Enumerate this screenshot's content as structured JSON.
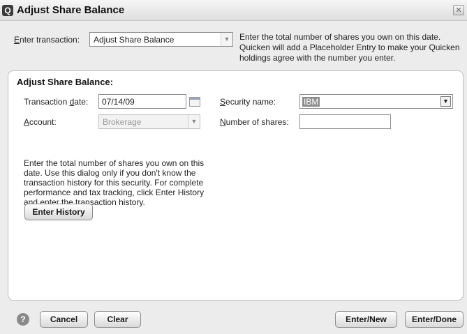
{
  "window": {
    "app_icon": "Q",
    "title": "Adjust Share Balance",
    "close_glyph": "✕"
  },
  "header": {
    "enter_transaction_label": "Enter transaction:",
    "transaction_type_value": "Adjust Share Balance",
    "info_text": "Enter the total number of shares you own on this date. Quicken will add a Placeholder Entry to make your Quicken holdings agree with the number you enter."
  },
  "panel": {
    "title": "Adjust Share Balance:",
    "transaction_date_label": "Transaction date:",
    "transaction_date_value": "07/14/09",
    "account_label": "Account:",
    "account_value": "Brokerage",
    "security_name_label": "Security name:",
    "security_name_value": "IBM",
    "number_of_shares_label": "Number of shares:",
    "number_of_shares_value": "",
    "description": "Enter the total number of shares you own on this date.  Use this dialog only if you don't know the transaction history for this security.  For complete performance and tax tracking, click Enter History and enter the transaction history.",
    "enter_history_label": "Enter History"
  },
  "footer": {
    "help_glyph": "?",
    "cancel_label": "Cancel",
    "clear_label": "Clear",
    "enter_new_label": "Enter/New",
    "enter_done_label": "Enter/Done"
  },
  "icons": {
    "app": "quicken-logo-icon",
    "close": "close-icon",
    "calendar": "calendar-icon",
    "dropdown": "chevron-down-icon",
    "help": "help-icon"
  }
}
